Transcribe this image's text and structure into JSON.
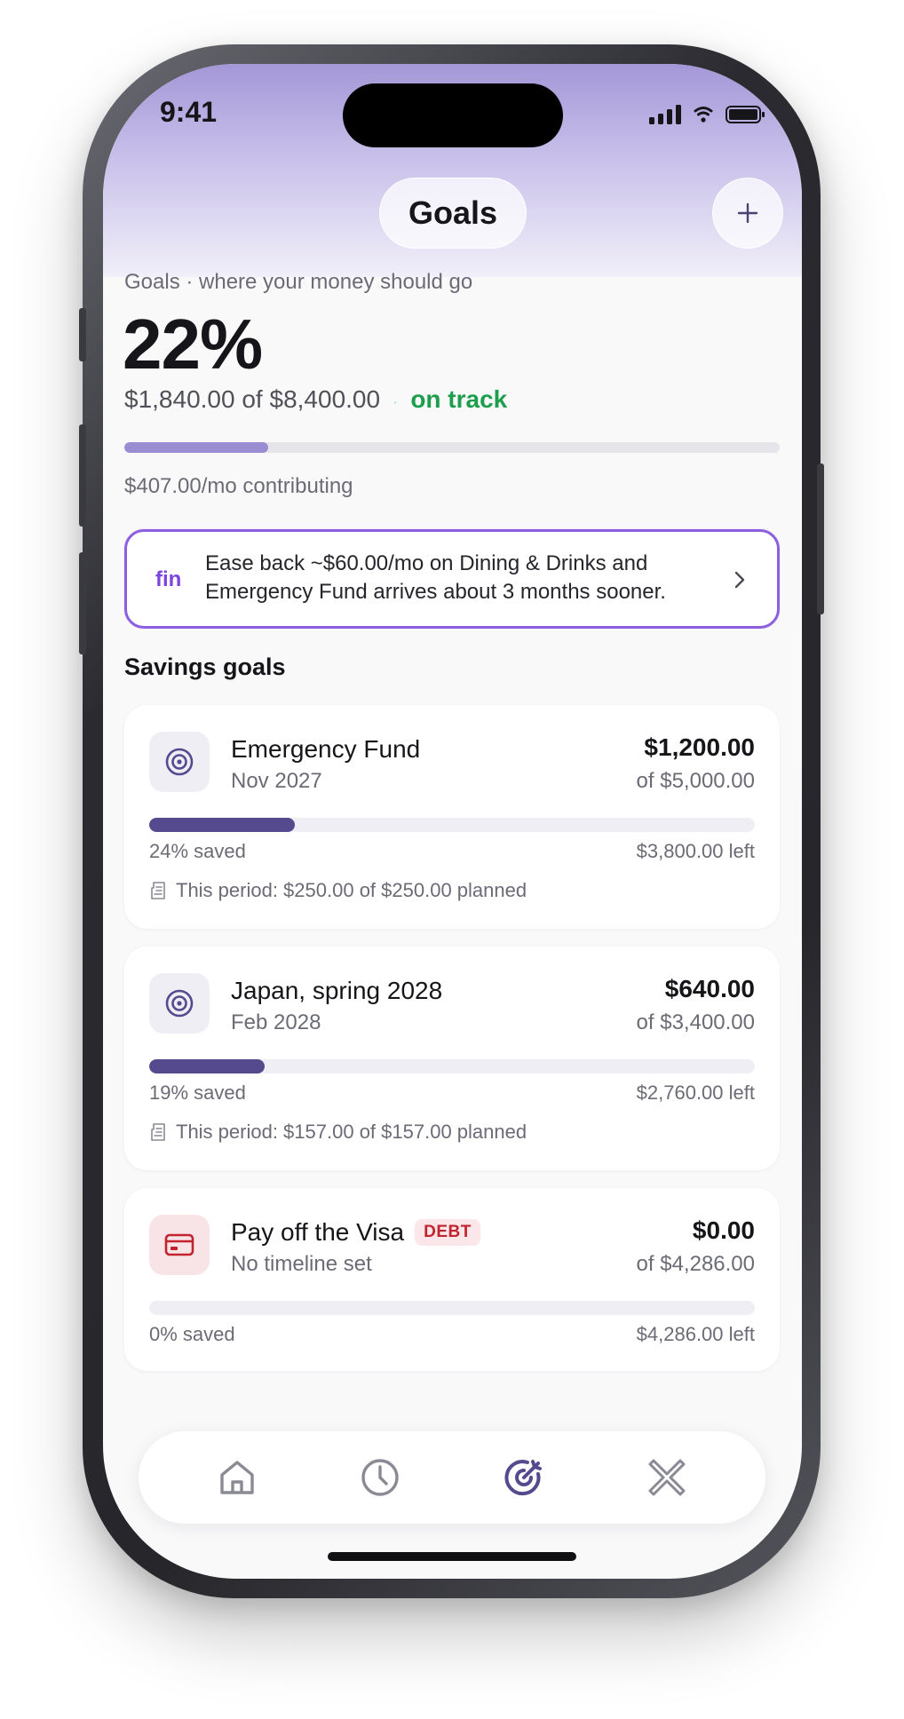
{
  "status_bar": {
    "time": "9:41"
  },
  "header": {
    "title": "Goals",
    "add_icon": "plus-icon"
  },
  "overview": {
    "caption": "Goals · where your money should go",
    "percent": "22%",
    "saved": "$1,840.00",
    "of_word": "of",
    "target": "$8,400.00",
    "separator": "·",
    "status": "on track",
    "progress_fraction": 0.22,
    "contribution": "$407.00/mo contributing"
  },
  "fin_tip": {
    "brand": "fin",
    "message": "Ease back ~$60.00/mo on Dining & Drinks and Emergency Fund arrives about 3 months sooner."
  },
  "section_title": "Savings goals",
  "goals": [
    {
      "name": "Emergency Fund",
      "date": "Nov 2027",
      "amount": "$1,200.00",
      "target": "of $5,000.00",
      "progress_fraction": 0.24,
      "saved_label": "24% saved",
      "left_label": "$3,800.00 left",
      "period": "This period: $250.00 of $250.00 planned",
      "icon": "target-icon"
    },
    {
      "name": "Japan, spring 2028",
      "date": "Feb 2028",
      "amount": "$640.00",
      "target": "of $3,400.00",
      "progress_fraction": 0.19,
      "saved_label": "19% saved",
      "left_label": "$2,760.00 left",
      "period": "This period: $157.00 of $157.00 planned",
      "icon": "target-icon"
    },
    {
      "name": "Pay off the Visa",
      "badge": "DEBT",
      "date": "No timeline set",
      "amount": "$0.00",
      "target": "of $4,286.00",
      "progress_fraction": 0.0,
      "saved_label": "0% saved",
      "left_label": "$4,286.00 left",
      "icon": "credit-card-icon"
    }
  ],
  "tabbar": {
    "items": [
      {
        "icon": "home-icon",
        "active": false
      },
      {
        "icon": "clock-icon",
        "active": false
      },
      {
        "icon": "goals-target-icon",
        "active": true
      },
      {
        "icon": "tools-icon",
        "active": false
      }
    ]
  },
  "colors": {
    "accent": "#564a8f",
    "overview_bar": "#9b8dd2",
    "success": "#1c9e4d",
    "fin_border": "#8b5fe0",
    "debt": "#c2232f"
  }
}
